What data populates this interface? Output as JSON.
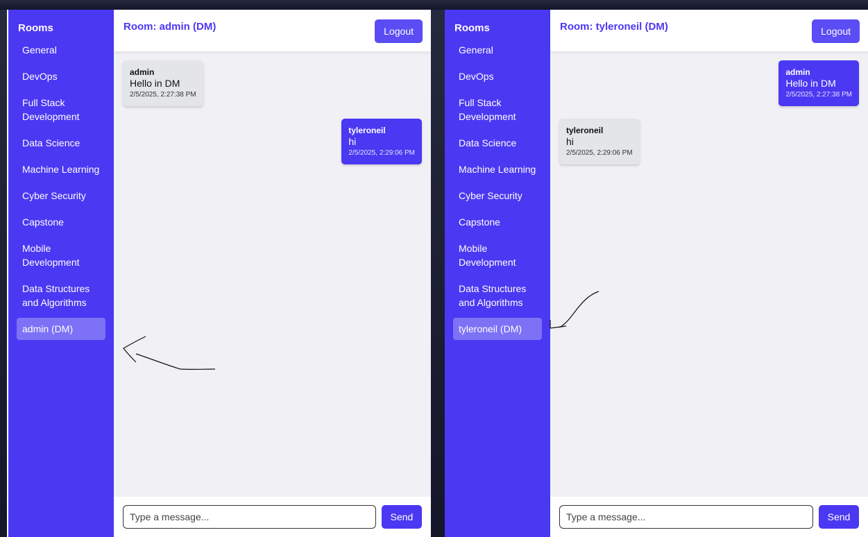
{
  "colors": {
    "accent": "#4b38f2",
    "active_room": "#7d71f6",
    "chat_bg": "#f0f0f5",
    "other_bubble": "#e3e5e8"
  },
  "left": {
    "sidebar_title": "Rooms",
    "rooms": [
      "General",
      "DevOps",
      "Full Stack Development",
      "Data Science",
      "Machine Learning",
      "Cyber Security",
      "Capstone",
      "Mobile Development",
      "Data Structures and Algorithms"
    ],
    "active_room": "admin (DM)",
    "room_title": "Room: admin (DM)",
    "logout_label": "Logout",
    "messages": [
      {
        "sender": "admin",
        "text": "Hello in DM",
        "time": "2/5/2025, 2:27:38 PM",
        "own": false
      },
      {
        "sender": "tyleroneil",
        "text": "hi",
        "time": "2/5/2025, 2:29:06 PM",
        "own": true
      }
    ],
    "input_placeholder": "Type a message...",
    "send_label": "Send"
  },
  "right": {
    "sidebar_title": "Rooms",
    "rooms": [
      "General",
      "DevOps",
      "Full Stack Development",
      "Data Science",
      "Machine Learning",
      "Cyber Security",
      "Capstone",
      "Mobile Development",
      "Data Structures and Algorithms"
    ],
    "active_room": "tyleroneil (DM)",
    "room_title": "Room: tyleroneil (DM)",
    "logout_label": "Logout",
    "messages": [
      {
        "sender": "admin",
        "text": "Hello in DM",
        "time": "2/5/2025, 2:27:38 PM",
        "own": true
      },
      {
        "sender": "tyleroneil",
        "text": "hi",
        "time": "2/5/2025, 2:29:06 PM",
        "own": false
      }
    ],
    "input_placeholder": "Type a message...",
    "send_label": "Send"
  }
}
